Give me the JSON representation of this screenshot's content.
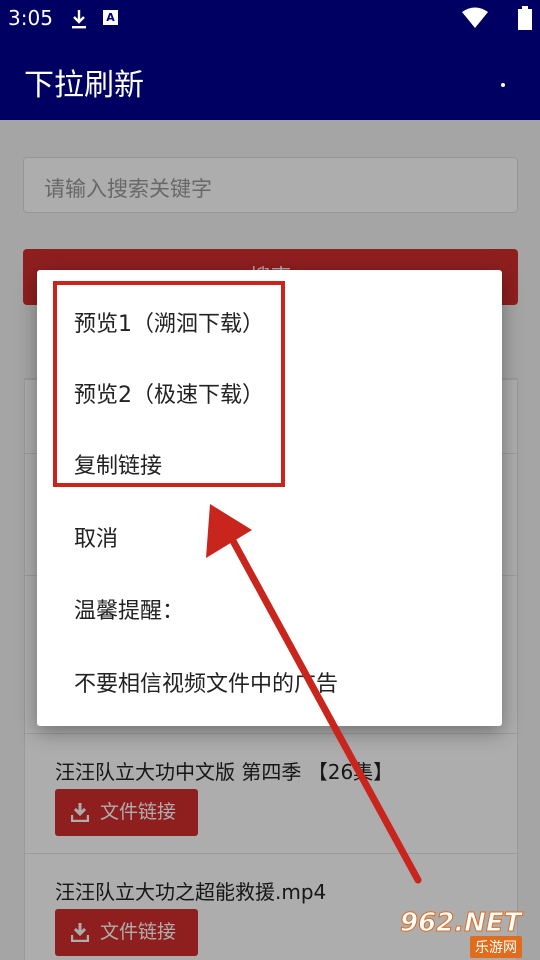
{
  "status_bar": {
    "time": "3:05",
    "icons": [
      "download-icon",
      "a-icon",
      "wifi-icon",
      "battery-icon"
    ],
    "a_icon_text": "A"
  },
  "app_bar": {
    "title": "下拉刷新",
    "color": "#00008b"
  },
  "search": {
    "placeholder": "请输入搜索关键字",
    "button_label": "搜索"
  },
  "list": {
    "items": [
      {
        "name": "汪汪队立大功中文版 第四季 【26集】",
        "button_label": "文件链接"
      },
      {
        "name": "汪汪队立大功之超能救援.mp4",
        "button_label": "文件链接"
      }
    ]
  },
  "dialog": {
    "options": [
      "预览1（溯洄下载）",
      "预览2（极速下载）",
      "复制链接",
      "取消",
      "温馨提醒：",
      "不要相信视频文件中的广告"
    ]
  },
  "colors": {
    "accent": "#d32f2f",
    "annotation": "#c8251d"
  },
  "watermark": {
    "top": "962.NET",
    "bottom": "乐游网"
  }
}
